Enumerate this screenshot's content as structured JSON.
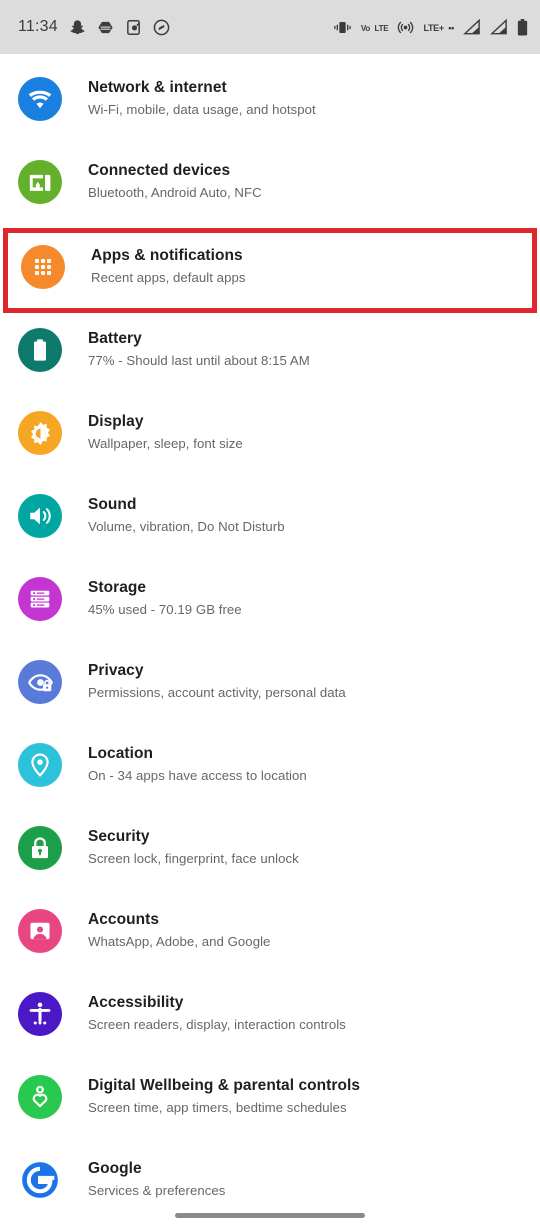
{
  "statusbar": {
    "time": "11:34",
    "left_icons": [
      "snapchat-icon",
      "hexagon-app-icon",
      "phone-app-icon",
      "shazam-icon"
    ],
    "right_icons": [
      "vibrate-icon",
      "volte-icon",
      "hotspot-icon",
      "lte-plus-icon",
      "signal-bars-sim1-icon",
      "signal-bars-sim2-icon",
      "battery-icon"
    ],
    "volte_label_top": "VoLTE",
    "volte_line1": "Vo",
    "volte_line2": "LTE",
    "lte_label": "LTE+",
    "lte_dots": "••",
    "background": "#dcdcdc"
  },
  "highlight": {
    "color": "#e0262e",
    "target": "Apps & notifications"
  },
  "settings": {
    "items": [
      {
        "title": "Network & internet",
        "subtitle": "Wi-Fi, mobile, data usage, and hotspot",
        "icon": "wifi-icon",
        "color": "#1a80e0",
        "highlighted": false
      },
      {
        "title": "Connected devices",
        "subtitle": "Bluetooth, Android Auto, NFC",
        "icon": "cast-devices-icon",
        "color": "#63b02a",
        "highlighted": false
      },
      {
        "title": "Apps & notifications",
        "subtitle": "Recent apps, default apps",
        "icon": "app-grid-icon",
        "color": "#f5892c",
        "highlighted": true
      },
      {
        "title": "Battery",
        "subtitle": "77% - Should last until about 8:15 AM",
        "icon": "battery-icon",
        "color": "#0f7a6c",
        "highlighted": false
      },
      {
        "title": "Display",
        "subtitle": "Wallpaper, sleep, font size",
        "icon": "brightness-icon",
        "color": "#f5a623",
        "highlighted": false
      },
      {
        "title": "Sound",
        "subtitle": "Volume, vibration, Do Not Disturb",
        "icon": "speaker-icon",
        "color": "#00a7a2",
        "highlighted": false
      },
      {
        "title": "Storage",
        "subtitle": "45% used - 70.19 GB free",
        "icon": "storage-stack-icon",
        "color": "#c436d2",
        "highlighted": false
      },
      {
        "title": "Privacy",
        "subtitle": "Permissions, account activity, personal data",
        "icon": "eye-lock-icon",
        "color": "#5a7ada",
        "highlighted": false
      },
      {
        "title": "Location",
        "subtitle": "On - 34 apps have access to location",
        "icon": "location-pin-icon",
        "color": "#2cc2da",
        "highlighted": false
      },
      {
        "title": "Security",
        "subtitle": "Screen lock, fingerprint, face unlock",
        "icon": "lock-icon",
        "color": "#1d9e49",
        "highlighted": false
      },
      {
        "title": "Accounts",
        "subtitle": "WhatsApp, Adobe, and Google",
        "icon": "account-card-icon",
        "color": "#e94580",
        "highlighted": false
      },
      {
        "title": "Accessibility",
        "subtitle": "Screen readers, display, interaction controls",
        "icon": "accessibility-icon",
        "color": "#4a18c6",
        "highlighted": false
      },
      {
        "title": "Digital Wellbeing & parental controls",
        "subtitle": "Screen time, app timers, bedtime schedules",
        "icon": "wellbeing-heart-icon",
        "color": "#29c94f",
        "highlighted": false
      },
      {
        "title": "Google",
        "subtitle": "Services & preferences",
        "icon": "google-g-icon",
        "color": "#1a73e8",
        "highlighted": false
      }
    ]
  },
  "navbar": {
    "handle": "gesture-nav-handle",
    "color": "#8a8a8a"
  }
}
